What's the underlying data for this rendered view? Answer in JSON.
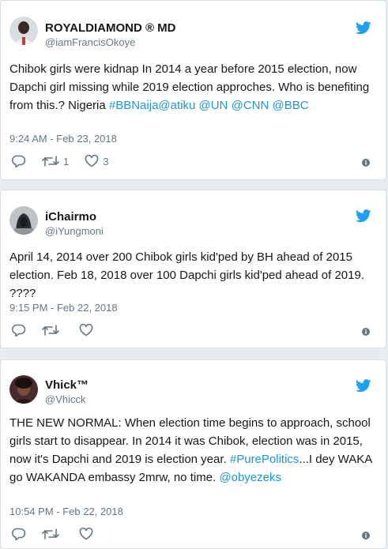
{
  "colors": {
    "link": "#1b95e0",
    "twitter_blue": "#1da1f2",
    "muted": "#657786",
    "background": "#e6ecf0"
  },
  "tweets": [
    {
      "display_name": "ROYALDIAMOND ® MD",
      "handle": "@iamFrancisOkoye",
      "text_segments": [
        {
          "text": "Chibok girls were kidnap In 2014 a year before 2015 election, now Dapchi girl missing while 2019 election approches. Who is benefiting from this.? Nigeria ",
          "link": false
        },
        {
          "text": "#BBNaija",
          "link": true
        },
        {
          "text": "@atiku",
          "link": true
        },
        {
          "text": " ",
          "link": false
        },
        {
          "text": "@UN",
          "link": true
        },
        {
          "text": " ",
          "link": false
        },
        {
          "text": "@CNN",
          "link": true
        },
        {
          "text": " ",
          "link": false
        },
        {
          "text": "@BBC",
          "link": true
        }
      ],
      "timestamp": "9:24 AM - Feb 23, 2018",
      "retweets": "1",
      "likes": "3",
      "icons": [
        "reply-icon",
        "retweet-icon",
        "heart-icon",
        "info-icon",
        "twitter-bird-icon"
      ]
    },
    {
      "display_name": "iChairmo",
      "handle": "@iYungmoni",
      "text_segments": [
        {
          "text": "April 14, 2014 over 200 Chibok girls kid'ped by BH ahead of 2015 election. Feb 18, 2018 over 100 Dapchi girls kid'ped ahead of 2019. ????",
          "link": false
        }
      ],
      "timestamp": "9:15 PM - Feb 22, 2018",
      "retweets": "",
      "likes": "",
      "icons": [
        "reply-icon",
        "retweet-icon",
        "heart-icon",
        "info-icon",
        "twitter-bird-icon"
      ]
    },
    {
      "display_name": "Vhick™",
      "handle": "@Vhicck",
      "text_segments": [
        {
          "text": "THE NEW NORMAL: When election time begins to approach, school girls start to disappear. In 2014 it was Chibok,  election was in 2015,  now it's Dapchi and 2019 is election year. ",
          "link": false
        },
        {
          "text": "#PurePolitics",
          "link": true
        },
        {
          "text": "...I dey WAKA go WAKANDA embassy 2mrw, no time. ",
          "link": false
        },
        {
          "text": "@obyezeks",
          "link": true
        }
      ],
      "timestamp": "10:54 PM - Feb 22, 2018",
      "retweets": "",
      "likes": "",
      "icons": [
        "reply-icon",
        "retweet-icon",
        "heart-icon",
        "info-icon",
        "twitter-bird-icon"
      ]
    }
  ]
}
